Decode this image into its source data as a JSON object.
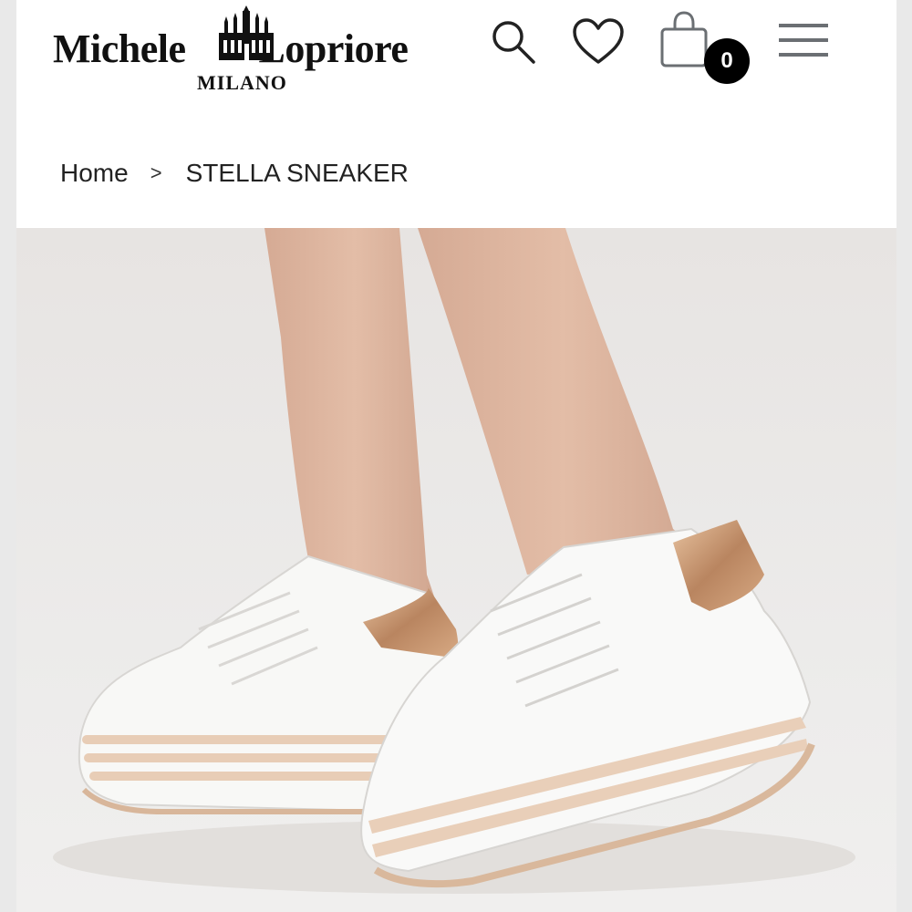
{
  "brand": {
    "name_left": "Michele",
    "name_right": "Lopriore",
    "city": "MILANO"
  },
  "header": {
    "icons": [
      "search-icon",
      "heart-icon",
      "shopping-bag-icon",
      "hamburger-menu-icon"
    ],
    "cart_count": "0"
  },
  "breadcrumb": {
    "home": "Home",
    "separator": ">",
    "current": "STELLA SNEAKER"
  },
  "product_image": {
    "subject": "white platform sneakers with rose-gold heel tab"
  },
  "colors": {
    "icon_dark": "#222222",
    "icon_muted": "#6b6f73",
    "badge_bg": "#000000",
    "accent_rose_gold": "#c99a72"
  }
}
